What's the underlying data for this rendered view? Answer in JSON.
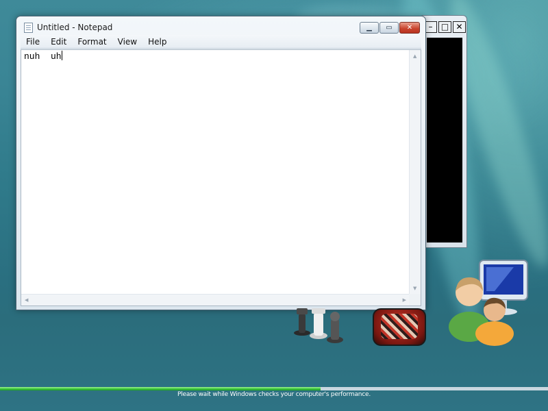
{
  "notepad": {
    "title": "Untitled - Notepad",
    "menu": [
      "File",
      "Edit",
      "Format",
      "View",
      "Help"
    ],
    "content": "nuh  uh",
    "icons": [
      "notepad-app-icon",
      "minimize-icon",
      "maximize-icon",
      "close-icon"
    ]
  },
  "background_window": {
    "icons": [
      "minimize-icon",
      "maximize-icon",
      "close-icon"
    ]
  },
  "desktop": {
    "decorations": [
      "chess-pieces",
      "mahjong-tile",
      "users-with-monitor"
    ]
  },
  "status": {
    "message": "Please wait while Windows checks your computer's performance.",
    "progress": 0.585
  },
  "colors": {
    "progress_fill": "#37c23a",
    "close_button": "#c8422c",
    "desktop_background": "#2f7a8a"
  }
}
